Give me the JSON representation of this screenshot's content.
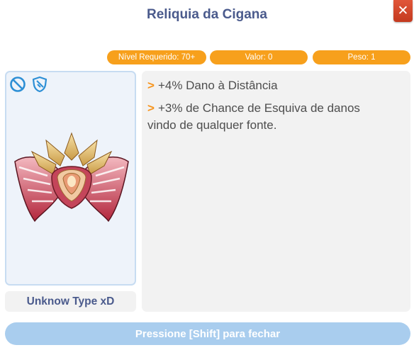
{
  "window": {
    "title": "Reliquia da Cigana",
    "close_label": "✕"
  },
  "stats": {
    "level": "Nível Requerido: 70+",
    "value": "Valor: 0",
    "weight": "Peso: 1"
  },
  "item": {
    "type": "Unknow Type xD",
    "icons": [
      "no-trade-icon",
      "shield-icon"
    ]
  },
  "description": {
    "bullet": ">",
    "lines": [
      "+4% Dano à Distância",
      "+3% de Chance de Esquiva de danos vindo de qualquer fonte."
    ]
  },
  "footer": {
    "close_hint": "Pressione [Shift] para fechar"
  },
  "colors": {
    "accent": "#f7a01c",
    "title": "#4a5a8c",
    "close": "#d64a2d",
    "footer": "#a9cdee"
  }
}
